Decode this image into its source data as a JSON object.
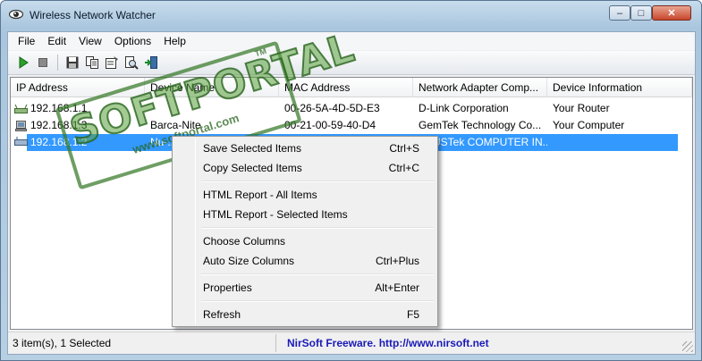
{
  "window": {
    "title": "Wireless Network Watcher",
    "controls": {
      "minimize": "–",
      "maximize": "□",
      "close": "✕"
    }
  },
  "menubar": [
    "File",
    "Edit",
    "View",
    "Options",
    "Help"
  ],
  "toolbar": {
    "icons": [
      "start-icon",
      "stop-icon",
      "save-icon",
      "copy-icon",
      "properties-icon",
      "find-icon",
      "exit-icon"
    ]
  },
  "list": {
    "columns": [
      "IP Address",
      "Device Name",
      "MAC Address",
      "Network Adapter Comp...",
      "Device Information"
    ],
    "rows": [
      {
        "icon": "router-icon",
        "ip": "192.168.1.1",
        "name": "",
        "mac": "00-26-5A-4D-5D-E3",
        "adapter": "D-Link Corporation",
        "info": "Your Router",
        "selected": false
      },
      {
        "icon": "computer-icon",
        "ip": "192.168.1.3",
        "name": "Barca-Nite",
        "mac": "00-21-00-59-40-D4",
        "adapter": "GemTek Technology Co...",
        "info": "Your Computer",
        "selected": false
      },
      {
        "icon": "device-icon",
        "ip": "192.168.1.2",
        "name": "Nu-...",
        "mac": "",
        "adapter": "ASUSTek COMPUTER IN...",
        "info": "",
        "selected": true
      }
    ]
  },
  "context_menu": {
    "groups": [
      [
        {
          "label": "Save Selected Items",
          "shortcut": "Ctrl+S"
        },
        {
          "label": "Copy Selected Items",
          "shortcut": "Ctrl+C"
        }
      ],
      [
        {
          "label": "HTML Report - All Items",
          "shortcut": ""
        },
        {
          "label": "HTML Report - Selected Items",
          "shortcut": ""
        }
      ],
      [
        {
          "label": "Choose Columns",
          "shortcut": ""
        },
        {
          "label": "Auto Size Columns",
          "shortcut": "Ctrl+Plus"
        }
      ],
      [
        {
          "label": "Properties",
          "shortcut": "Alt+Enter"
        }
      ],
      [
        {
          "label": "Refresh",
          "shortcut": "F5"
        }
      ]
    ]
  },
  "statusbar": {
    "count": "3 item(s), 1 Selected",
    "credit": "NirSoft Freeware.  http://www.nirsoft.net"
  },
  "watermark": {
    "main": "SOFTPORTAL",
    "tm": "TM",
    "url": "www.softportal.com"
  },
  "colors": {
    "selection": "#3399ff",
    "credit_link": "#1a1ab8",
    "watermark_green": "#367828"
  }
}
